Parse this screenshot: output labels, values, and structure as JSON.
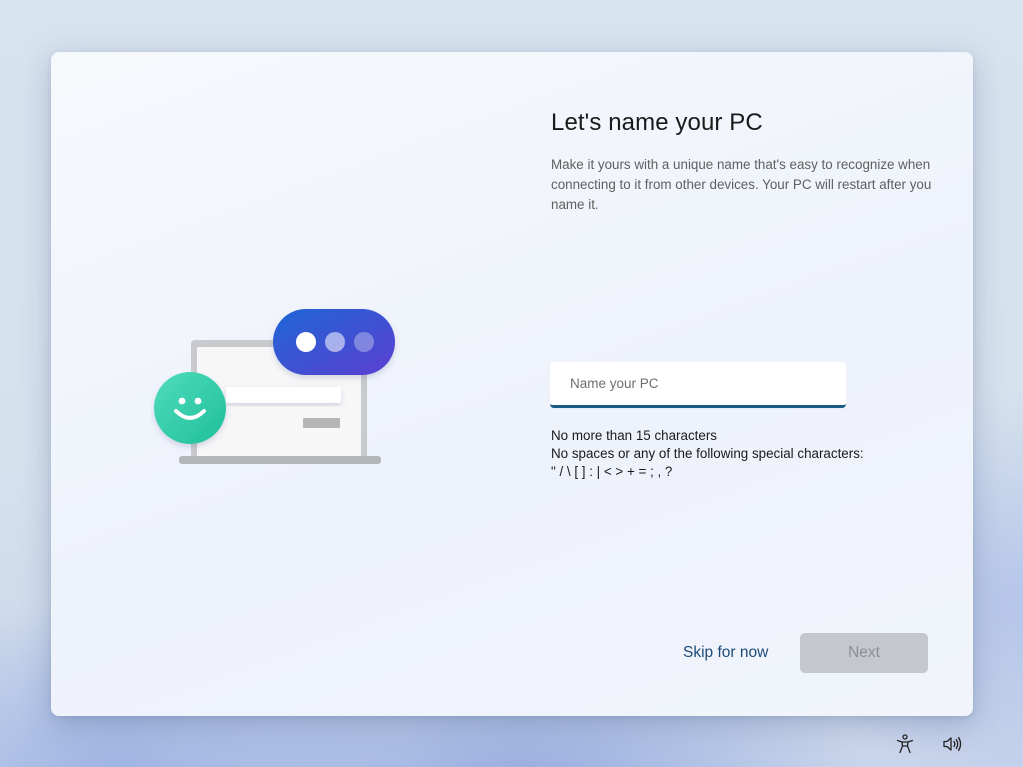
{
  "page": {
    "title": "Let's name your PC",
    "description": "Make it yours with a unique name that's easy to recognize when connecting to it from other devices. Your PC will restart after you name it."
  },
  "name_input": {
    "value": "",
    "placeholder": "Name your PC"
  },
  "rules": [
    "No more than 15 characters",
    "No spaces or any of the following special characters:",
    "\" / \\ [ ] : | < > + = ; , ?"
  ],
  "actions": {
    "skip_label": "Skip for now",
    "next_label": "Next",
    "next_enabled": false
  },
  "illustration": {
    "icon": "pc-naming-illustration",
    "bubble_color_start": "#1f66d6",
    "bubble_color_end": "#5b3fd0",
    "smiley_color": "#2fcfa8"
  },
  "tray": {
    "icons": [
      "accessibility-icon",
      "volume-icon"
    ]
  },
  "colors": {
    "accent": "#1b5c87",
    "link": "#1c4a78",
    "disabled_button": "#c4c7cc"
  }
}
